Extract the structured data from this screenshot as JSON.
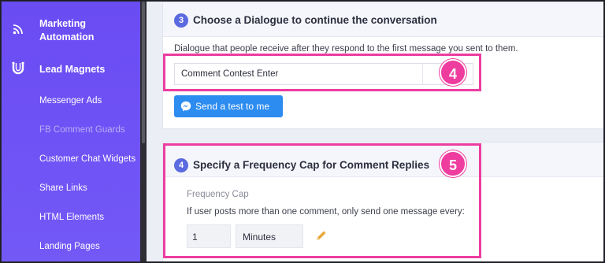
{
  "sidebar": {
    "marketing_automation": "Marketing\nAutomation",
    "lead_magnets": "Lead Magnets",
    "items": [
      {
        "label": "Messenger Ads"
      },
      {
        "label": "FB Comment Guards"
      },
      {
        "label": "Customer Chat Widgets"
      },
      {
        "label": "Share Links"
      },
      {
        "label": "HTML Elements"
      },
      {
        "label": "Landing Pages"
      }
    ]
  },
  "step3": {
    "number": "3",
    "title": "Choose a Dialogue to continue the conversation",
    "description": "Dialogue that people receive after they respond to the first message you sent to them.",
    "selected_dialogue": "Comment Contest Enter",
    "test_button": "Send a test to me"
  },
  "step4": {
    "number": "4",
    "title": "Specify a Frequency Cap for Comment Replies",
    "field_label": "Frequency Cap",
    "field_description": "If user posts more than one comment, only send one message every:",
    "value": "1",
    "unit": "Minutes"
  },
  "annotations": {
    "badge_1": "4",
    "badge_2": "5"
  },
  "colors": {
    "sidebar": "#6f52f5",
    "accent": "#2d8cf0",
    "highlight": "#ec3da0",
    "step_badge": "#5b6ae0"
  },
  "icons": {
    "marketing": "rss-icon",
    "lead_magnets": "magnet-icon",
    "test_button": "messenger-icon",
    "edit": "pencil-icon"
  }
}
